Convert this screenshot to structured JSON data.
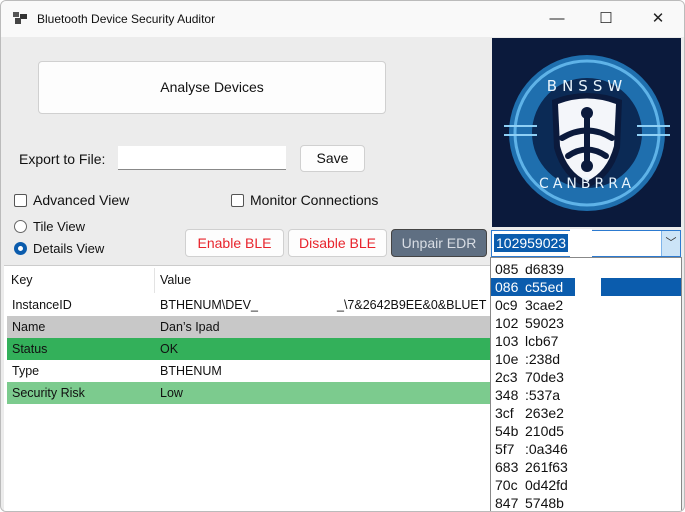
{
  "window": {
    "title": "Bluetooth Device Security Auditor",
    "minimize": "—",
    "maximize": "☐",
    "close": "✕"
  },
  "analyse_label": "Analyse Devices",
  "export": {
    "label": "Export to File:",
    "value": "",
    "save_label": "Save"
  },
  "options": {
    "advanced_view": "Advanced View",
    "monitor_connections": "Monitor Connections",
    "tile_view": "Tile View",
    "details_view": "Details View"
  },
  "actions": {
    "enable_ble": "Enable BLE",
    "disable_ble": "Disable BLE",
    "unpair_edr": "Unpair EDR"
  },
  "logo": {
    "top_text": "BNSSW",
    "bottom_text": "CANBRRA"
  },
  "colors": {
    "name_row": "#c8c8c8",
    "status_row": "#33b05a",
    "risk_row": "#7ccb8e",
    "danger_text": "#e8242c",
    "unpair_bg": "#5f6f82"
  },
  "table": {
    "headers": [
      "Key",
      "Value"
    ],
    "rows": [
      {
        "key": "InstanceID",
        "value": "BTHENUM\\DEV_",
        "value_tail": "_\\7&2642B9EE&0&BLUET"
      },
      {
        "key": "Name",
        "value": "Dan’s Ipad"
      },
      {
        "key": "Status",
        "value": "OK"
      },
      {
        "key": "Type",
        "value": "BTHENUM"
      },
      {
        "key": "Security Risk",
        "value": "Low"
      }
    ]
  },
  "device_combo": {
    "selected": "102959023",
    "items": [
      [
        "085",
        "d6839"
      ],
      [
        "086",
        "c55ed"
      ],
      [
        "0c9",
        "3cae2"
      ],
      [
        "102",
        "59023"
      ],
      [
        "103",
        "lcb67"
      ],
      [
        "10e",
        ":238d"
      ],
      [
        "2c3",
        "70de3"
      ],
      [
        "348",
        ":537a"
      ],
      [
        "3cf",
        "263e2"
      ],
      [
        "54b",
        "210d5"
      ],
      [
        "5f7",
        ":0a346"
      ],
      [
        "683",
        "261f63"
      ],
      [
        "70c",
        "0d42fd"
      ],
      [
        "847",
        "5748b"
      ]
    ]
  }
}
